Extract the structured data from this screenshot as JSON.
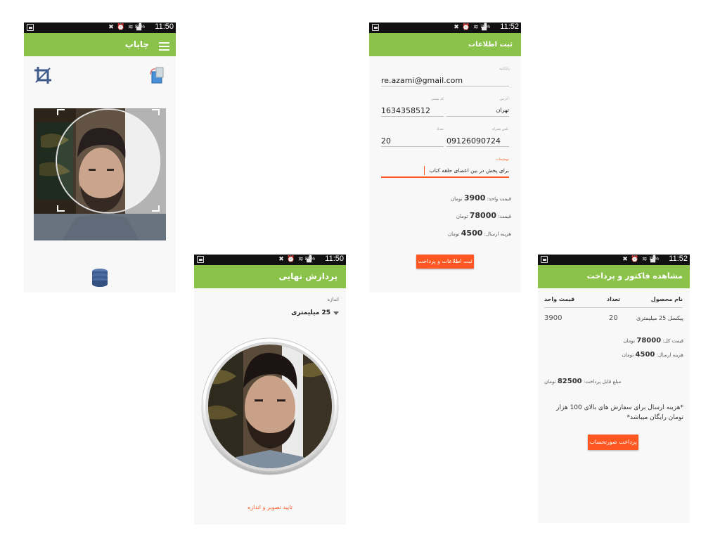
{
  "status": {
    "s1": {
      "battery": "80%",
      "time": "11:50"
    },
    "s2": {
      "battery": "80%",
      "time": "11:50"
    },
    "s3": {
      "battery": "79%",
      "time": "11:52"
    },
    "s4": {
      "battery": "79%",
      "time": "11:52"
    }
  },
  "screen1": {
    "title": "چاپاپ"
  },
  "screen2": {
    "title": "پردازش نهایی",
    "size_label": "اندازه",
    "size_value": "25 میلیمتری",
    "confirm_label": "تایید تصویر و اندازه"
  },
  "screen3": {
    "title": "ثبت اطلاعات",
    "email_label": "رایانامه",
    "email_value": "re.azami@gmail.com",
    "postal_label": "کد پستی",
    "postal_value": "1634358512",
    "address_label": "آدرس",
    "address_value": "تهران",
    "count_label": "تعداد",
    "count_value": "20",
    "phone_label": "تلفن همراه",
    "phone_value": "09126090724",
    "notes_label": "توضیحات",
    "notes_value": "برای پخش در بین اعضای حلقه کتاب",
    "unit_price_label": "قیمت واحد:",
    "unit_price_value": "3900",
    "unit_price_unit": "تومان",
    "price_label": "قیمت:",
    "price_value": "78000",
    "price_unit": "تومان",
    "shipping_label": "هزینه ارسال:",
    "shipping_value": "4500",
    "shipping_unit": "تومان",
    "submit_label": "ثبت اطلاعات و پرداخت"
  },
  "screen4": {
    "title": "مشاهده فاکتور و پرداخت",
    "table_headers": [
      "نام محصول",
      "تعداد",
      "قیمت واحد"
    ],
    "row": {
      "product": "پیکسل 25 میلیمتری",
      "count": "20",
      "unit_price": "3900"
    },
    "total_label": "قیمت کل:",
    "total_value": "78000",
    "total_unit": "تومان",
    "shipping_label": "هزینه ارسال:",
    "shipping_value": "4500",
    "shipping_unit": "تومان",
    "payable_label": "مبلغ قابل پرداخت:",
    "payable_value": "82500",
    "payable_unit": "تومان",
    "note": "*هزینه ارسال برای سفارش های بالای 100 هزار تومان رایگان میباشد*",
    "pay_label": "پرداخت صورتحساب"
  },
  "colors": {
    "appbar": "#8bc34a",
    "accent": "#ff5722",
    "statusbar": "#111111"
  },
  "icons": [
    "menu-icon",
    "crop-icon",
    "rotate-icon",
    "database-icon",
    "dropdown-arrow-icon"
  ]
}
